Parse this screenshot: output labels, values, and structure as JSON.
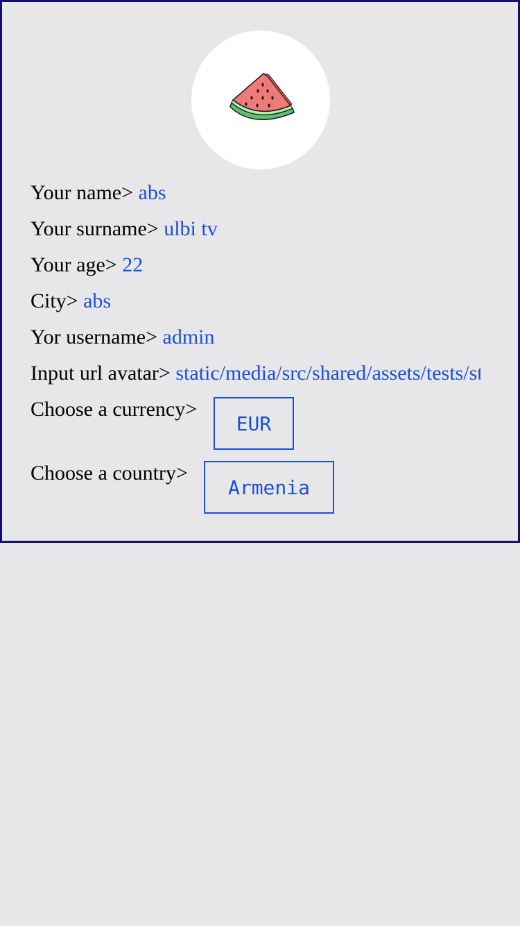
{
  "profile": {
    "avatar_alt": "watermelon-avatar",
    "fields": {
      "name": {
        "label": "Your name>",
        "value": "abs"
      },
      "surname": {
        "label": "Your surname>",
        "value": "ulbi tv"
      },
      "age": {
        "label": "Your age>",
        "value": "22"
      },
      "city": {
        "label": "City>",
        "value": "abs"
      },
      "username": {
        "label": "Yor username>",
        "value": "admin"
      },
      "avatar_url": {
        "label": "Input url avatar>",
        "value": "static/media/src/shared/assets/tests/storybook.jpg"
      }
    },
    "currency": {
      "label": "Choose a currency>",
      "selected": "EUR"
    },
    "country": {
      "label": "Choose a country>",
      "selected": "Armenia"
    }
  },
  "colors": {
    "accent": "#1a4fd8",
    "border": "#101070",
    "background": "#e7e7ea"
  }
}
